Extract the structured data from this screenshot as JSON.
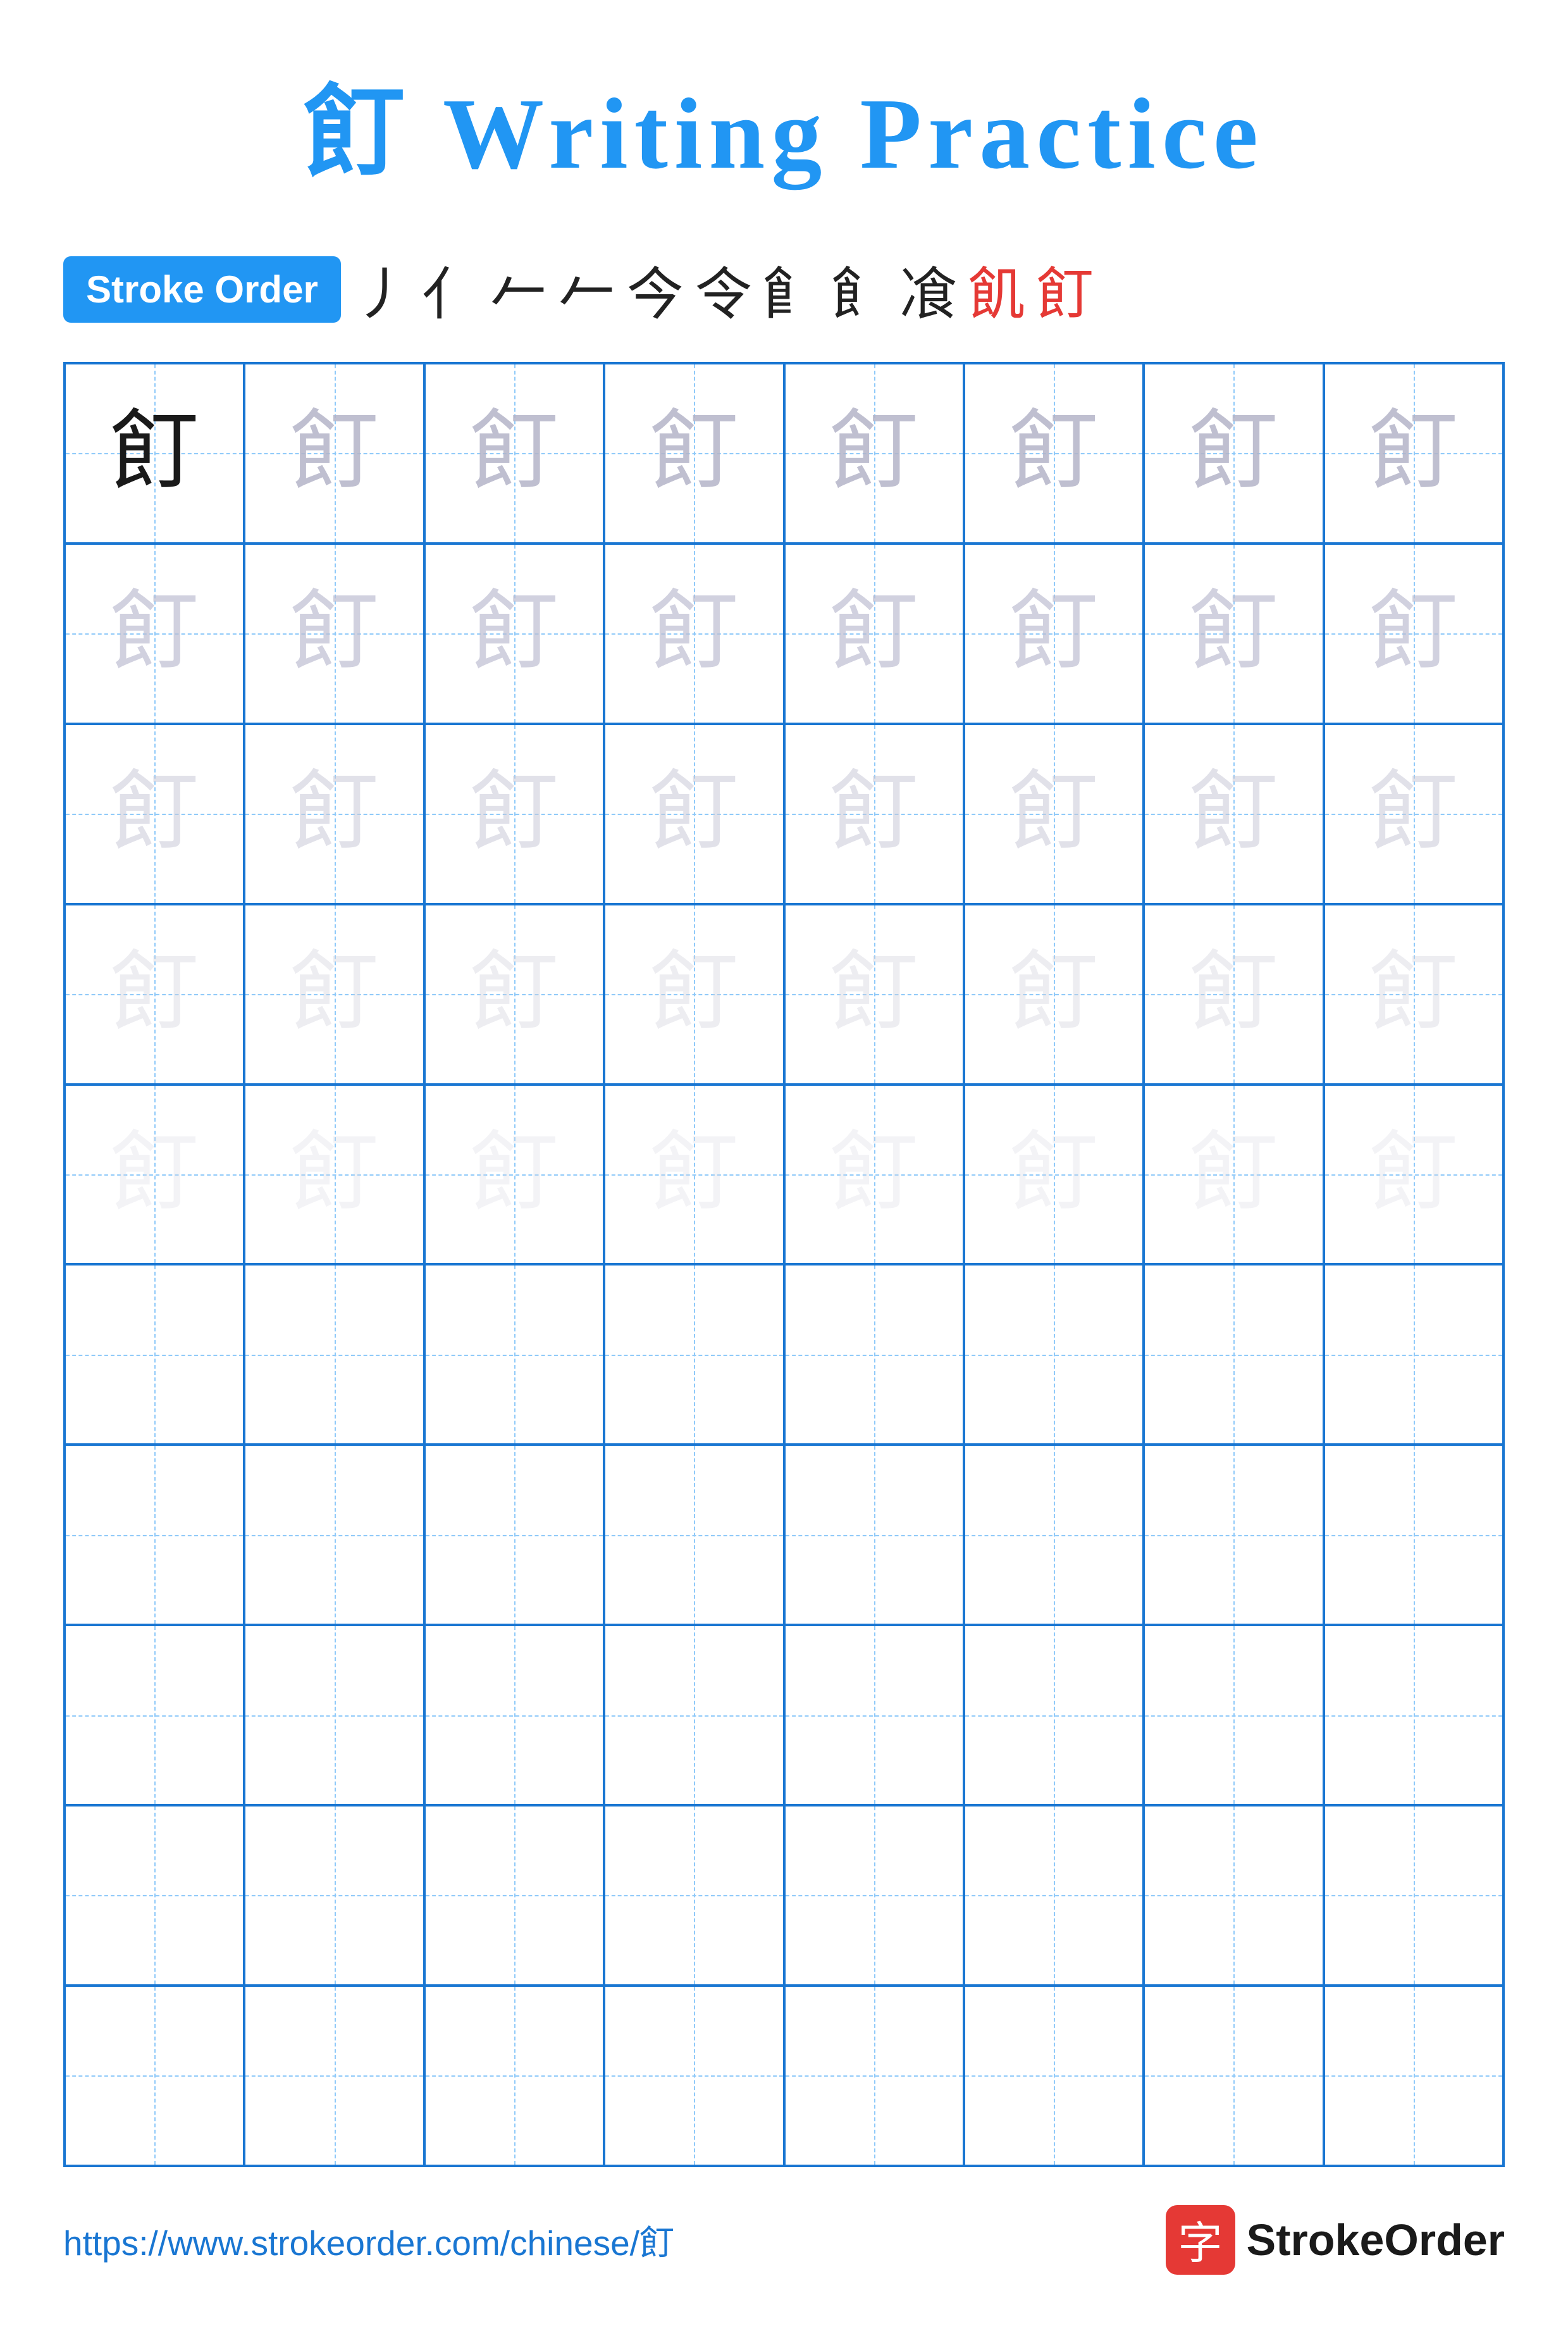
{
  "title": {
    "character": "飣",
    "suffix": " Writing Practice"
  },
  "stroke_order": {
    "badge_label": "Stroke Order",
    "strokes": [
      "丿",
      "亻",
      "𠂉",
      "𠂉",
      "今",
      "令",
      "𩙿",
      "飠",
      "飡",
      "飢",
      "飣"
    ]
  },
  "grid": {
    "cols": 8,
    "rows": 10,
    "character": "飣",
    "practice_rows": 5,
    "empty_rows": 5
  },
  "footer": {
    "url": "https://www.strokeorder.com/chinese/飣",
    "logo_char": "字",
    "logo_text": "StrokeOrder"
  }
}
